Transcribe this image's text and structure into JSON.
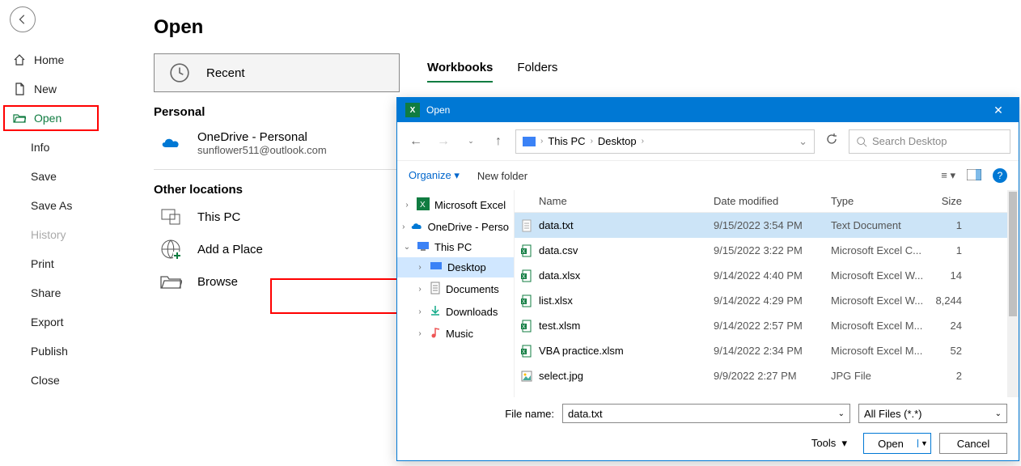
{
  "sidebar": {
    "home": "Home",
    "new": "New",
    "open": "Open",
    "info": "Info",
    "save": "Save",
    "save_as": "Save As",
    "history": "History",
    "print": "Print",
    "share": "Share",
    "export": "Export",
    "publish": "Publish",
    "close": "Close"
  },
  "page": {
    "title": "Open",
    "recent": "Recent",
    "personal_head": "Personal",
    "onedrive_title": "OneDrive - Personal",
    "onedrive_email": "sunflower511@outlook.com",
    "other_head": "Other locations",
    "this_pc": "This PC",
    "add_place": "Add a Place",
    "browse": "Browse"
  },
  "tabs": {
    "workbooks": "Workbooks",
    "folders": "Folders"
  },
  "dialog": {
    "title": "Open",
    "breadcrumb": {
      "root": "This PC",
      "current": "Desktop"
    },
    "search_placeholder": "Search Desktop",
    "organize": "Organize",
    "new_folder": "New folder",
    "tree": [
      {
        "label": "Microsoft Excel",
        "icon": "xl",
        "chevron": ">",
        "sub": false
      },
      {
        "label": "OneDrive - Perso",
        "icon": "cloud",
        "chevron": ">",
        "sub": false
      },
      {
        "label": "This PC",
        "icon": "pc",
        "chevron": "v",
        "sub": false
      },
      {
        "label": "Desktop",
        "icon": "desktop",
        "chevron": ">",
        "sub": true,
        "selected": true
      },
      {
        "label": "Documents",
        "icon": "doc",
        "chevron": ">",
        "sub": true
      },
      {
        "label": "Downloads",
        "icon": "dl",
        "chevron": ">",
        "sub": true
      },
      {
        "label": "Music",
        "icon": "music",
        "chevron": ">",
        "sub": true
      }
    ],
    "columns": {
      "name": "Name",
      "date": "Date modified",
      "type": "Type",
      "size": "Size"
    },
    "files": [
      {
        "name": "data.txt",
        "date": "9/15/2022 3:54 PM",
        "type": "Text Document",
        "size": "1",
        "icon": "txt",
        "selected": true
      },
      {
        "name": "data.csv",
        "date": "9/15/2022 3:22 PM",
        "type": "Microsoft Excel C...",
        "size": "1",
        "icon": "csv"
      },
      {
        "name": "data.xlsx",
        "date": "9/14/2022 4:40 PM",
        "type": "Microsoft Excel W...",
        "size": "14",
        "icon": "xlsx"
      },
      {
        "name": "list.xlsx",
        "date": "9/14/2022 4:29 PM",
        "type": "Microsoft Excel W...",
        "size": "8,244",
        "icon": "xlsx"
      },
      {
        "name": "test.xlsm",
        "date": "9/14/2022 2:57 PM",
        "type": "Microsoft Excel M...",
        "size": "24",
        "icon": "xlsm"
      },
      {
        "name": "VBA practice.xlsm",
        "date": "9/14/2022 2:34 PM",
        "type": "Microsoft Excel M...",
        "size": "52",
        "icon": "xlsm"
      },
      {
        "name": "select.jpg",
        "date": "9/9/2022 2:27 PM",
        "type": "JPG File",
        "size": "2",
        "icon": "jpg"
      }
    ],
    "filename_label": "File name:",
    "filename_value": "data.txt",
    "filter": "All Files (*.*)",
    "tools": "Tools",
    "open_btn": "Open",
    "cancel_btn": "Cancel"
  }
}
